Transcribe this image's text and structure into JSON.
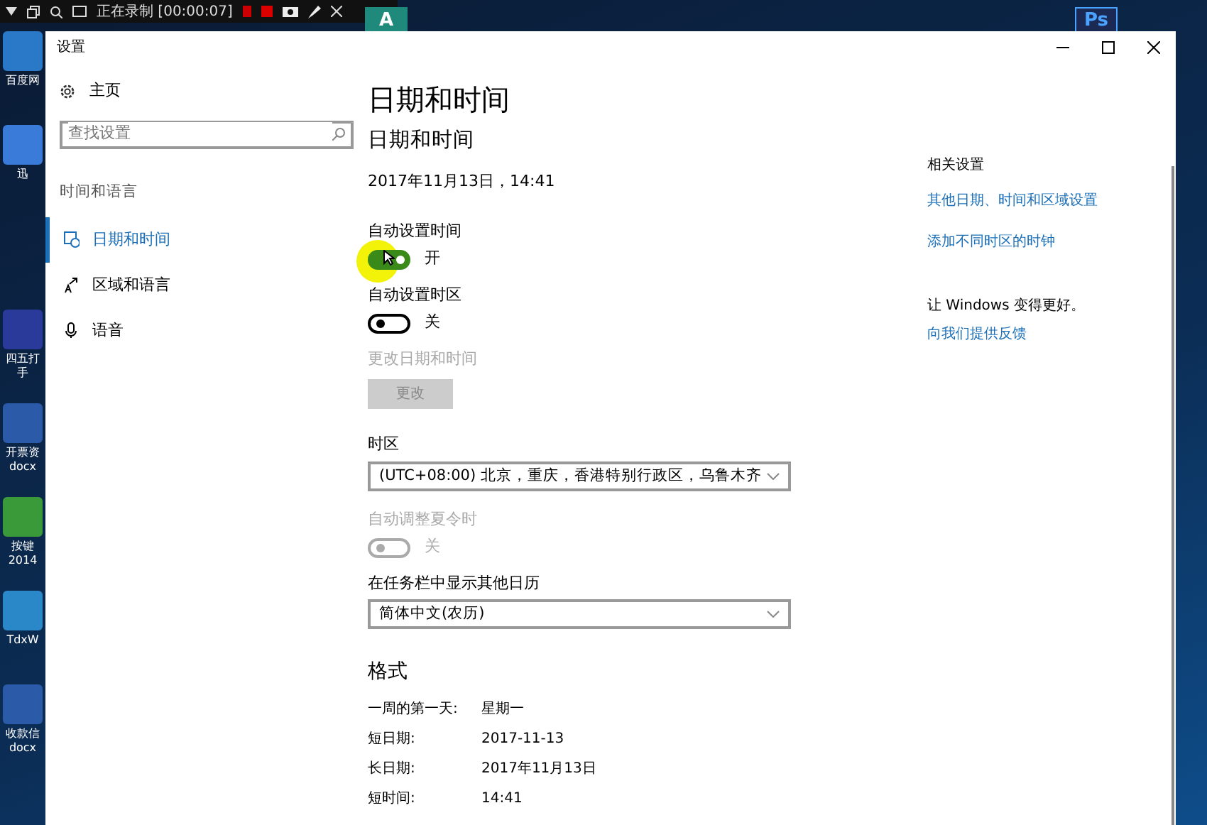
{
  "recorder_toolbar": {
    "status": "正在录制 [00:00:07]"
  },
  "desktop_icons": [
    {
      "lines": [
        "百度网"
      ]
    },
    {
      "lines": [
        "迅"
      ]
    },
    {
      "lines": [
        "四五打",
        "手"
      ]
    },
    {
      "lines": [
        "开票资",
        "docx"
      ]
    },
    {
      "lines": [
        "按键",
        "2014"
      ]
    },
    {
      "lines": [
        "TdxW"
      ]
    },
    {
      "lines": [
        "收款信",
        "docx"
      ]
    }
  ],
  "desktop_top_icons": [
    {
      "kind": "a",
      "label": "A"
    },
    {
      "kind": "ps",
      "label": "Ps"
    }
  ],
  "window": {
    "title": "设置"
  },
  "sidebar": {
    "home": "主页",
    "search": {
      "placeholder": "查找设置"
    },
    "section": "时间和语言",
    "items": [
      {
        "kind": "clock",
        "label": "日期和时间",
        "selected": true
      },
      {
        "kind": "region",
        "label": "区域和语言",
        "selected": false
      },
      {
        "kind": "mic",
        "label": "语音",
        "selected": false
      }
    ]
  },
  "main": {
    "title": "日期和时间",
    "subtitle": "日期和时间",
    "current": "2017年11月13日，14:41",
    "settings": [
      {
        "kind": "toggle",
        "label": "自动设置时间",
        "state": "开",
        "on": true,
        "disabled": false
      },
      {
        "kind": "toggle",
        "label": "自动设置时区",
        "state": "关",
        "on": false,
        "disabled": false
      },
      {
        "kind": "button",
        "label": "更改日期和时间",
        "button": "更改",
        "disabled": true
      },
      {
        "kind": "select",
        "label": "时区",
        "value": "(UTC+08:00) 北京，重庆，香港特别行政区，乌鲁木齐"
      },
      {
        "kind": "toggle",
        "label": "自动调整夏令时",
        "state": "关",
        "on": false,
        "disabled": true
      },
      {
        "kind": "select",
        "label": "在任务栏中显示其他日历",
        "value": "简体中文(农历)"
      }
    ],
    "format_title": "格式",
    "formats": [
      {
        "label": "一周的第一天:",
        "value": "星期一"
      },
      {
        "label": "短日期:",
        "value": "2017-11-13"
      },
      {
        "label": "长日期:",
        "value": "2017年11月13日"
      },
      {
        "label": "短时间:",
        "value": "14:41"
      }
    ]
  },
  "related": {
    "title": "相关设置",
    "links": [
      "其他日期、时间和区域设置",
      "添加不同时区的时钟"
    ],
    "feedback_text": "让 Windows 变得更好。",
    "feedback_link": "向我们提供反馈"
  }
}
